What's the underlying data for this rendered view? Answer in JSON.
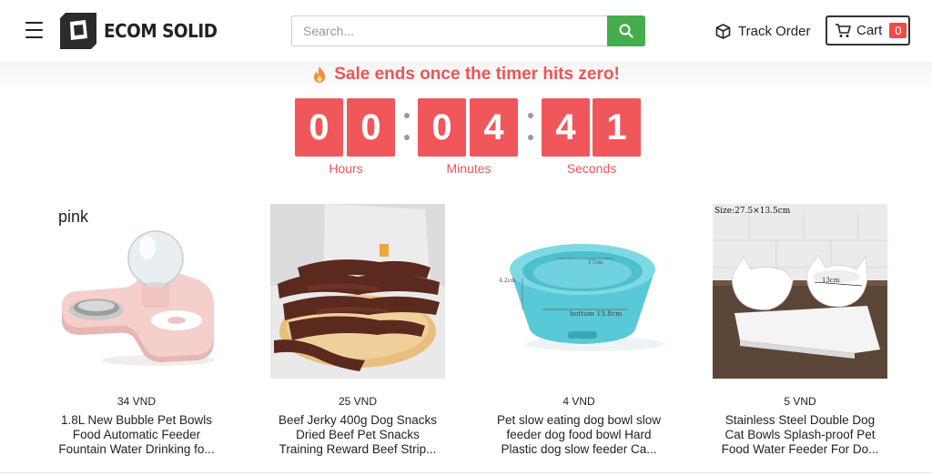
{
  "header": {
    "logo_text": "ECOM SOLID",
    "search_placeholder": "Search...",
    "track_order_label": "Track Order",
    "cart_label": "Cart",
    "cart_count": "0"
  },
  "sale": {
    "title": "Sale ends once the timer hits zero!",
    "digits": [
      "0",
      "0",
      "0",
      "4",
      "4",
      "1"
    ],
    "units": [
      "Hours",
      "Minutes",
      "Seconds"
    ]
  },
  "products": [
    {
      "image_text": "pink",
      "price": "34 VND",
      "name_lines": [
        "1.8L New Bubble Pet Bowls",
        "Food Automatic Feeder",
        "Fountain Water Drinking fo..."
      ]
    },
    {
      "image_text": "",
      "price": "25 VND",
      "name_lines": [
        "Beef Jerky 400g Dog Snacks",
        "Dried Beef Pet Snacks",
        "Training Reward Beef Strip..."
      ]
    },
    {
      "image_text": "",
      "price": "4 VND",
      "name_lines": [
        "Pet slow eating dog bowl slow",
        "feeder dog food bowl Hard",
        "Plastic dog slow feeder Ca..."
      ]
    },
    {
      "image_text": "Size:27.5×13.5cm",
      "price": "5 VND",
      "name_lines": [
        "Stainless Steel Double Dog",
        "Cat Bowls Splash-proof Pet",
        "Food Water Feeder For Do..."
      ]
    }
  ],
  "colors": {
    "accent_red": "#f0575a",
    "search_green": "#45ad4f",
    "sale_text": "#ef5454"
  },
  "icons": [
    "menu-icon",
    "logo-icon",
    "search-icon",
    "package-icon",
    "cart-icon",
    "fire-icon"
  ]
}
